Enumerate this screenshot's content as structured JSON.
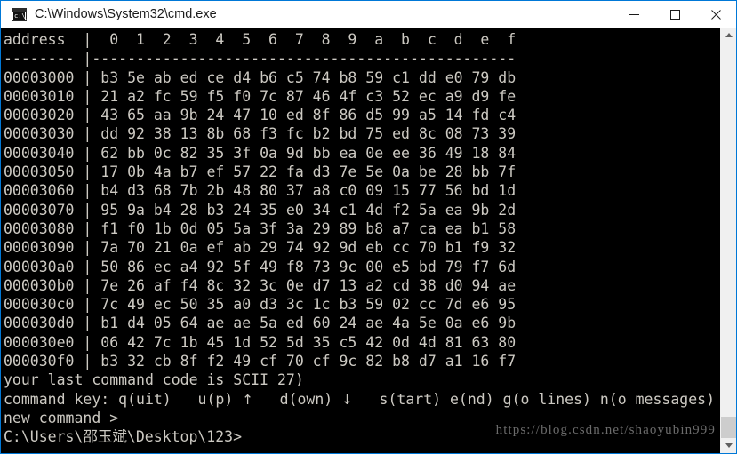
{
  "window": {
    "title": "C:\\Windows\\System32\\cmd.exe",
    "icon": "cmd-console-icon",
    "accent_color": "#0078d7",
    "background": "#ffffff",
    "buttons": [
      {
        "name": "minimize",
        "label": "—"
      },
      {
        "name": "maximize",
        "label": "□"
      },
      {
        "name": "close",
        "label": "✕"
      }
    ]
  },
  "console": {
    "background": "#000000",
    "foreground": "#ccc9c2",
    "header": "address  | 0  1  2  3  4  5  6  7  8  9  a  b  c  d  e  f",
    "separator": "-------- +-------------------------------------------------",
    "address_label": "address",
    "column_headers": [
      "0",
      "1",
      "2",
      "3",
      "4",
      "5",
      "6",
      "7",
      "8",
      "9",
      "a",
      "b",
      "c",
      "d",
      "e",
      "f"
    ],
    "rows": [
      {
        "address": "00003000",
        "bytes": [
          "b3",
          "5e",
          "ab",
          "ed",
          "ce",
          "d4",
          "b6",
          "c5",
          "74",
          "b8",
          "59",
          "c1",
          "dd",
          "e0",
          "79",
          "db"
        ]
      },
      {
        "address": "00003010",
        "bytes": [
          "21",
          "a2",
          "fc",
          "59",
          "f5",
          "f0",
          "7c",
          "87",
          "46",
          "4f",
          "c3",
          "52",
          "ec",
          "a9",
          "d9",
          "fe"
        ]
      },
      {
        "address": "00003020",
        "bytes": [
          "43",
          "65",
          "aa",
          "9b",
          "24",
          "47",
          "10",
          "ed",
          "8f",
          "86",
          "d5",
          "99",
          "a5",
          "14",
          "fd",
          "c4"
        ]
      },
      {
        "address": "00003030",
        "bytes": [
          "dd",
          "92",
          "38",
          "13",
          "8b",
          "68",
          "f3",
          "fc",
          "b2",
          "bd",
          "75",
          "ed",
          "8c",
          "08",
          "73",
          "39"
        ]
      },
      {
        "address": "00003040",
        "bytes": [
          "62",
          "bb",
          "0c",
          "82",
          "35",
          "3f",
          "0a",
          "9d",
          "bb",
          "ea",
          "0e",
          "ee",
          "36",
          "49",
          "18",
          "84"
        ]
      },
      {
        "address": "00003050",
        "bytes": [
          "17",
          "0b",
          "4a",
          "b7",
          "ef",
          "57",
          "22",
          "fa",
          "d3",
          "7e",
          "5e",
          "0a",
          "be",
          "28",
          "bb",
          "7f"
        ]
      },
      {
        "address": "00003060",
        "bytes": [
          "b4",
          "d3",
          "68",
          "7b",
          "2b",
          "48",
          "80",
          "37",
          "a8",
          "c0",
          "09",
          "15",
          "77",
          "56",
          "bd",
          "1d"
        ]
      },
      {
        "address": "00003070",
        "bytes": [
          "95",
          "9a",
          "b4",
          "28",
          "b3",
          "24",
          "35",
          "e0",
          "34",
          "c1",
          "4d",
          "f2",
          "5a",
          "ea",
          "9b",
          "2d"
        ]
      },
      {
        "address": "00003080",
        "bytes": [
          "f1",
          "f0",
          "1b",
          "0d",
          "05",
          "5a",
          "3f",
          "3a",
          "29",
          "89",
          "b8",
          "a7",
          "ca",
          "ea",
          "b1",
          "58"
        ]
      },
      {
        "address": "00003090",
        "bytes": [
          "7a",
          "70",
          "21",
          "0a",
          "ef",
          "ab",
          "29",
          "74",
          "92",
          "9d",
          "eb",
          "cc",
          "70",
          "b1",
          "f9",
          "32"
        ]
      },
      {
        "address": "000030a0",
        "bytes": [
          "50",
          "86",
          "ec",
          "a4",
          "92",
          "5f",
          "49",
          "f8",
          "73",
          "9c",
          "00",
          "e5",
          "bd",
          "79",
          "f7",
          "6d"
        ]
      },
      {
        "address": "000030b0",
        "bytes": [
          "7e",
          "26",
          "af",
          "f4",
          "8c",
          "32",
          "3c",
          "0e",
          "d7",
          "13",
          "a2",
          "cd",
          "38",
          "d0",
          "94",
          "ae"
        ]
      },
      {
        "address": "000030c0",
        "bytes": [
          "7c",
          "49",
          "ec",
          "50",
          "35",
          "a0",
          "d3",
          "3c",
          "1c",
          "b3",
          "59",
          "02",
          "cc",
          "7d",
          "e6",
          "95"
        ]
      },
      {
        "address": "000030d0",
        "bytes": [
          "b1",
          "d4",
          "05",
          "64",
          "ae",
          "ae",
          "5a",
          "ed",
          "60",
          "24",
          "ae",
          "4a",
          "5e",
          "0a",
          "e6",
          "9b"
        ]
      },
      {
        "address": "000030e0",
        "bytes": [
          "06",
          "42",
          "7c",
          "1b",
          "45",
          "1d",
          "52",
          "5d",
          "35",
          "c5",
          "42",
          "0d",
          "4d",
          "81",
          "63",
          "80"
        ]
      },
      {
        "address": "000030f0",
        "bytes": [
          "b3",
          "32",
          "cb",
          "8f",
          "f2",
          "49",
          "cf",
          "70",
          "cf",
          "9c",
          "82",
          "b8",
          "d7",
          "a1",
          "16",
          "f7"
        ]
      }
    ],
    "status_line": "your last command code is SCII 27)",
    "command_key_label": "command key: ",
    "command_keys": [
      {
        "label": "q(uit)",
        "glyph": ""
      },
      {
        "label": "u(p)",
        "glyph": "↑"
      },
      {
        "label": "d(own)",
        "glyph": "↓"
      },
      {
        "label": "s(tart)",
        "glyph": ""
      },
      {
        "label": "e(nd)",
        "glyph": ""
      },
      {
        "label": "g(o lines)",
        "glyph": ""
      },
      {
        "label": "n(o messages)",
        "glyph": ""
      }
    ],
    "command_key_line": "command key: q(uit)   u(p) ↑   d(own) ↓   s(tart) e(nd) g(o lines) n(o messages)",
    "new_command_line": "new command >",
    "prompt_line": "C:\\Users\\邵玉斌\\Desktop\\123>"
  },
  "scrollbar": {
    "up_arrow": "scroll-up",
    "down_arrow": "scroll-down",
    "track_color": "#f0f0f0",
    "thumb_color": "#cdcdcd"
  },
  "watermark": {
    "text": "https://blog.csdn.net/shaoyubin999"
  }
}
